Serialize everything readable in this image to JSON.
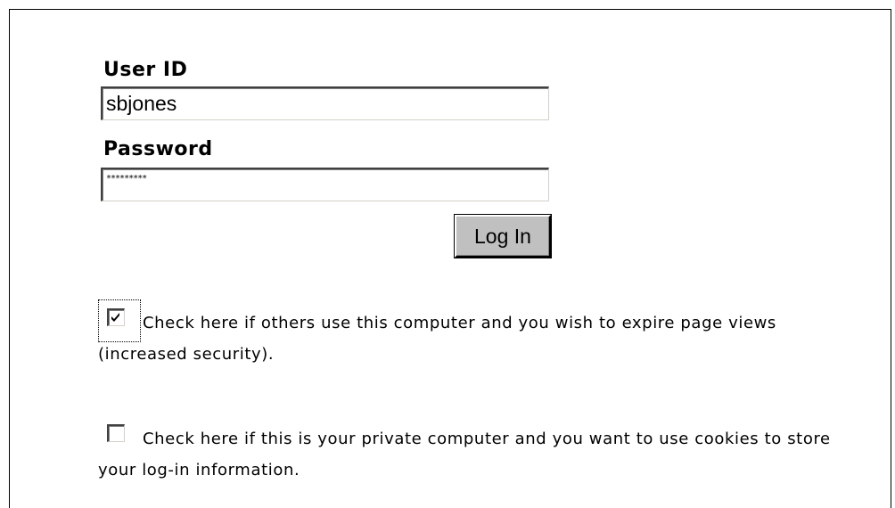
{
  "login_form": {
    "user_id_label": "User ID",
    "user_id_value": "sbjones",
    "password_label": "Password",
    "password_mask": "*********",
    "login_button_label": "Log In"
  },
  "options": [
    {
      "checked": true,
      "focused": true,
      "text": "Check here if others use this computer and you wish to expire page views (increased security)."
    },
    {
      "checked": false,
      "focused": false,
      "text": "Check here if this is your private computer and you want to use cookies to store your log-in information."
    }
  ]
}
